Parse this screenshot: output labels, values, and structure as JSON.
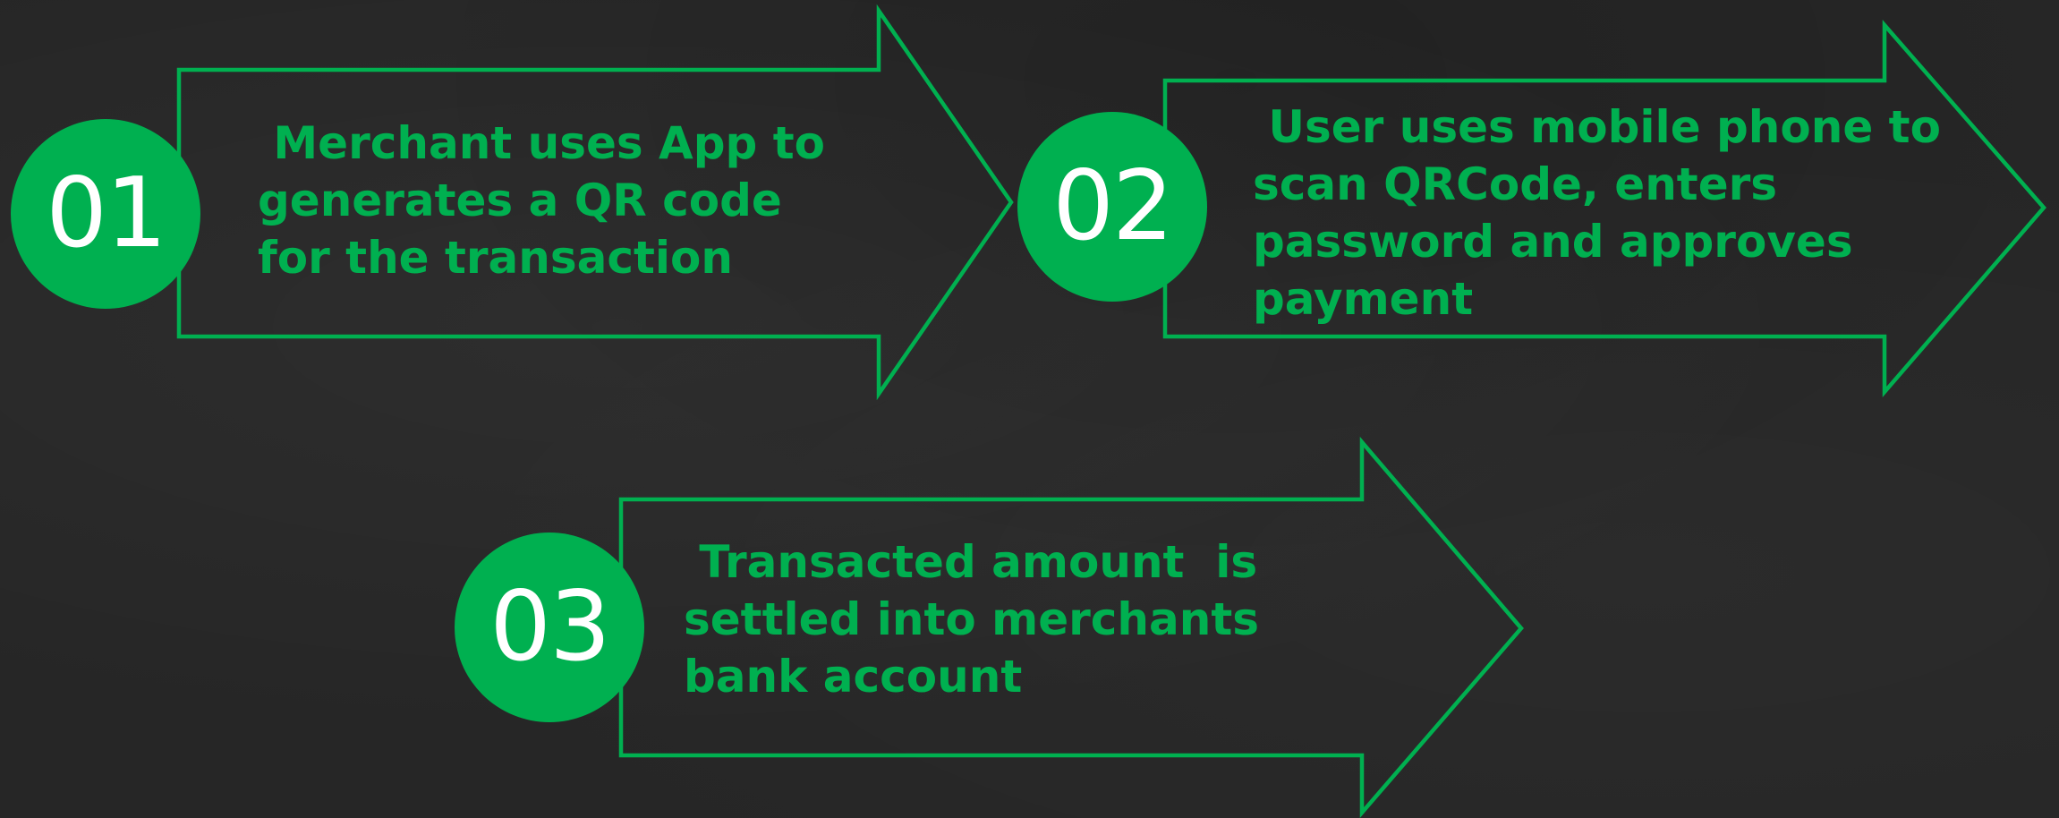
{
  "colors": {
    "background": "#262626",
    "accent": "#00b050",
    "badge_text": "#ffffff"
  },
  "steps": [
    {
      "number": "01",
      "text": " Merchant uses App to\ngenerates a QR code\nfor the transaction"
    },
    {
      "number": "02",
      "text": " User uses mobile phone to\nscan QRCode, enters\npassword and approves\npayment"
    },
    {
      "number": "03",
      "text": " Transacted amount  is\nsettled into merchants\nbank account"
    }
  ]
}
